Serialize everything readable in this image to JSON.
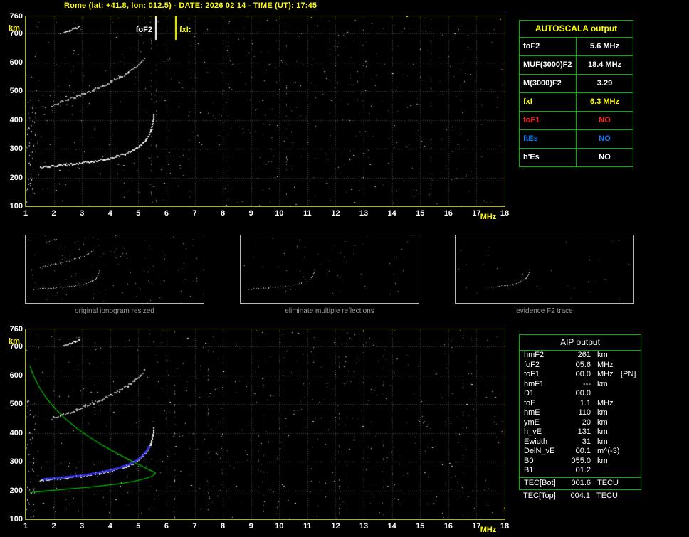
{
  "title": "Rome (lat: +41.8, lon: 012.5) - DATE: 2026 02 14 - TIME (UT): 17:45",
  "colors": {
    "title": "#ffff00",
    "axis_text": "#ffffff",
    "axis_unit": "#ffff00",
    "plot_border": "#b4b400",
    "grid": "#484848",
    "trace": "#ffffff",
    "profile_green": "#00b400",
    "fit_blue": "#2a2ad8",
    "table_border": "#00b400",
    "autoscala_header_text": "#ffff00",
    "caption_text": "#989898",
    "no_red": "#ff2020",
    "no_blue": "#0080ff"
  },
  "autoscala_table": {
    "header": "AUTOSCALA output",
    "rows": [
      {
        "label": "foF2",
        "value": "5.6 MHz",
        "color": "#ffffff"
      },
      {
        "label": "MUF(3000)F2",
        "value": "18.4 MHz",
        "color": "#ffffff"
      },
      {
        "label": "M(3000)F2",
        "value": "3.29",
        "color": "#ffffff"
      },
      {
        "label": "fxI",
        "value": "6.3 MHz",
        "color": "#ffff00"
      },
      {
        "label": "foF1",
        "value": "NO",
        "color": "#ff2020"
      },
      {
        "label": "ftEs",
        "value": "NO",
        "color": "#0080ff"
      },
      {
        "label": "h'Es",
        "value": "NO",
        "color": "#ffffff"
      }
    ]
  },
  "thumbnails": [
    {
      "caption": "original ionogram resized"
    },
    {
      "caption": "eliminate multiple reflections"
    },
    {
      "caption": "evidence F2 trace"
    }
  ],
  "aip_table": {
    "header": "AIP output",
    "rows": [
      {
        "label": "hmF2",
        "value": "261",
        "unit": "km",
        "extra": ""
      },
      {
        "label": "foF2",
        "value": "05.6",
        "unit": "MHz",
        "extra": ""
      },
      {
        "label": "foF1",
        "value": "00.0",
        "unit": "MHz",
        "extra": "[PN]"
      },
      {
        "label": "hmF1",
        "value": "---",
        "unit": "km",
        "extra": ""
      },
      {
        "label": "D1",
        "value": "00.0",
        "unit": "",
        "extra": ""
      },
      {
        "label": "foE",
        "value": "1.1",
        "unit": "MHz",
        "extra": ""
      },
      {
        "label": "hmE",
        "value": "110",
        "unit": "km",
        "extra": ""
      },
      {
        "label": "ymE",
        "value": "20",
        "unit": "km",
        "extra": ""
      },
      {
        "label": "h_vE",
        "value": "131",
        "unit": "km",
        "extra": ""
      },
      {
        "label": "Ewidth",
        "value": "31",
        "unit": "km",
        "extra": ""
      },
      {
        "label": "DelN_vE",
        "value": "00.1",
        "unit": "m^(-3)",
        "extra": ""
      },
      {
        "label": "B0",
        "value": "055.0",
        "unit": "km",
        "extra": ""
      },
      {
        "label": "B1",
        "value": "01.2",
        "unit": "",
        "extra": ""
      }
    ],
    "tec_rows": [
      {
        "label": "TEC[Bot]",
        "value": "001.6",
        "unit": "TECU",
        "extra": ""
      },
      {
        "label": "TEC[Top]",
        "value": "004.1",
        "unit": "TECU",
        "extra": ""
      }
    ]
  },
  "chart_data": {
    "type": "scatter",
    "title": "Ionogram (virtual height vs frequency) with AUTOSCALA interpretation",
    "xlabel": "MHz",
    "ylabel": "km",
    "xlim": [
      1,
      18
    ],
    "ylim": [
      100,
      760
    ],
    "x_ticks": [
      1,
      2,
      3,
      4,
      5,
      6,
      7,
      8,
      9,
      10,
      11,
      12,
      13,
      14,
      15,
      16,
      17,
      18
    ],
    "y_ticks": [
      760,
      700,
      600,
      500,
      400,
      300,
      200,
      100
    ],
    "grid": true,
    "markers": [
      {
        "name": "foF2",
        "label": "foF2",
        "freq": 5.6,
        "color": "#ffffff"
      },
      {
        "name": "fxI",
        "label": "fxI:",
        "freq": 6.3,
        "color": "#ffff00"
      }
    ],
    "series": [
      {
        "name": "F2 trace first hop",
        "color": "#ffffff",
        "points": [
          [
            1.5,
            238
          ],
          [
            1.8,
            240
          ],
          [
            2.1,
            243
          ],
          [
            2.4,
            246
          ],
          [
            2.7,
            249
          ],
          [
            3.0,
            253
          ],
          [
            3.3,
            257
          ],
          [
            3.6,
            262
          ],
          [
            3.9,
            268
          ],
          [
            4.2,
            275
          ],
          [
            4.5,
            284
          ],
          [
            4.75,
            294
          ],
          [
            4.95,
            305
          ],
          [
            5.1,
            317
          ],
          [
            5.25,
            332
          ],
          [
            5.35,
            348
          ],
          [
            5.43,
            366
          ],
          [
            5.48,
            385
          ],
          [
            5.51,
            403
          ],
          [
            5.53,
            420
          ]
        ]
      },
      {
        "name": "F2 trace second hop",
        "color": "#ffffff",
        "points": [
          [
            1.9,
            452
          ],
          [
            2.2,
            462
          ],
          [
            2.5,
            472
          ],
          [
            2.8,
            483
          ],
          [
            3.1,
            494
          ],
          [
            3.4,
            506
          ],
          [
            3.7,
            519
          ],
          [
            4.0,
            533
          ],
          [
            4.3,
            548
          ],
          [
            4.6,
            565
          ],
          [
            4.85,
            583
          ],
          [
            5.05,
            601
          ],
          [
            5.2,
            618
          ]
        ]
      },
      {
        "name": "third hop fragment",
        "color": "#ffffff",
        "points": [
          [
            2.35,
            706
          ],
          [
            2.55,
            713
          ],
          [
            2.75,
            720
          ],
          [
            2.9,
            726
          ]
        ]
      },
      {
        "name": "electron density profile",
        "color": "#00b400",
        "points": [
          [
            1.15,
            633
          ],
          [
            1.3,
            595
          ],
          [
            1.5,
            556
          ],
          [
            1.75,
            519
          ],
          [
            2.05,
            484
          ],
          [
            2.4,
            450
          ],
          [
            2.8,
            417
          ],
          [
            3.25,
            386
          ],
          [
            3.75,
            356
          ],
          [
            4.3,
            326
          ],
          [
            4.85,
            298
          ],
          [
            5.3,
            276
          ],
          [
            5.55,
            264
          ],
          [
            5.6,
            261
          ],
          [
            5.5,
            250
          ],
          [
            5.25,
            241
          ],
          [
            4.85,
            232
          ],
          [
            4.35,
            224
          ],
          [
            3.8,
            217
          ],
          [
            3.2,
            211
          ],
          [
            2.6,
            206
          ],
          [
            2.05,
            201
          ],
          [
            1.6,
            197
          ],
          [
            1.3,
            194
          ],
          [
            1.15,
            192
          ]
        ]
      },
      {
        "name": "autoscala fitted F2 trace",
        "color": "#2a2ad8",
        "points": [
          [
            1.6,
            239
          ],
          [
            2.0,
            242
          ],
          [
            2.4,
            246
          ],
          [
            2.8,
            250
          ],
          [
            3.2,
            255
          ],
          [
            3.6,
            262
          ],
          [
            4.0,
            270
          ],
          [
            4.4,
            281
          ],
          [
            4.7,
            292
          ],
          [
            4.95,
            305
          ],
          [
            5.15,
            320
          ],
          [
            5.3,
            338
          ],
          [
            5.4,
            356
          ]
        ]
      }
    ],
    "noise": {
      "seed": 73,
      "count": 620,
      "streaks": 9
    }
  }
}
